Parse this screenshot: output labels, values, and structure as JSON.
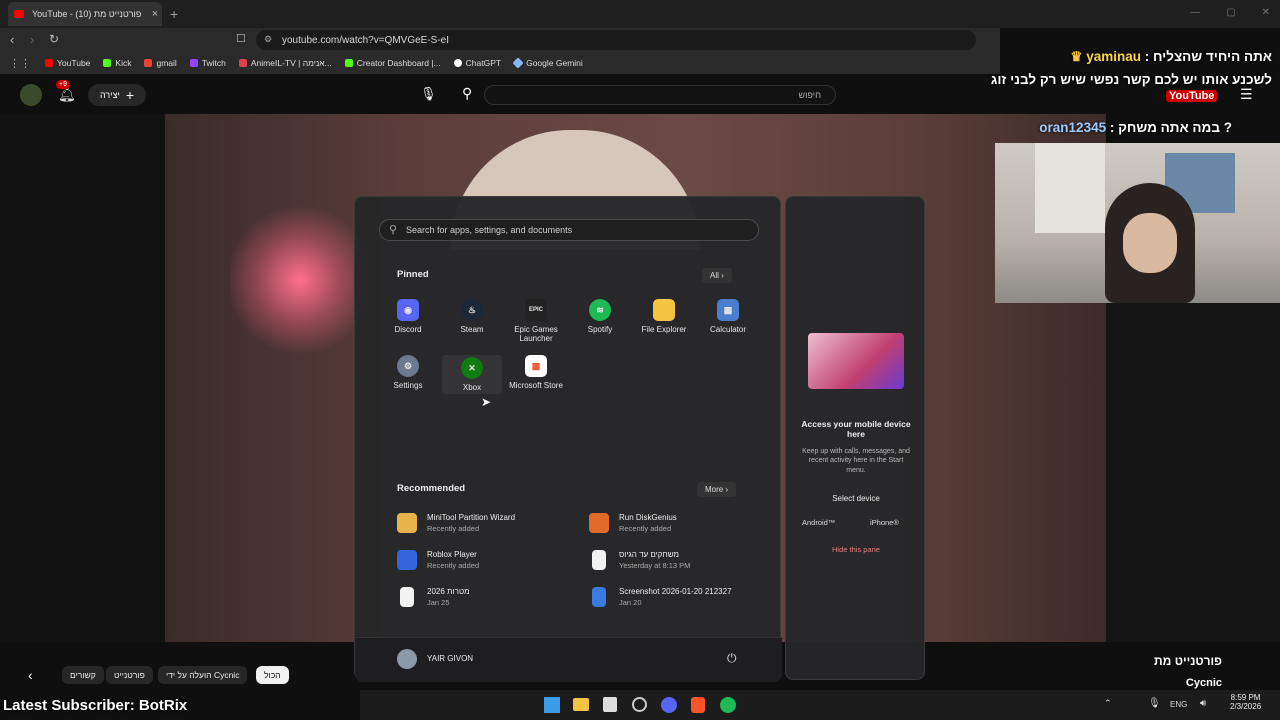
{
  "browser": {
    "tab_title": "YouTube - (10) פורטנייט מת",
    "new_tab_symbol": "+",
    "url": "youtube.com/watch?v=QMVGeE-S-eI",
    "bookmarks": [
      "YouTube",
      "Kick",
      "gmail",
      "Twitch",
      "AnimeIL-TV | אנימה...",
      "Creator Dashboard |...",
      "ChatGPT",
      "Google Gemini"
    ],
    "bookmark_colors": [
      "#ff0000",
      "#53fc18",
      "#ea4335",
      "#9146ff",
      "#e04050",
      "#53fc18",
      "#ffffff",
      "#8ab4f8"
    ]
  },
  "youtube": {
    "create_label": "יצירה",
    "notification_badge": "+9",
    "search_placeholder": "חיפוש",
    "logo_text": "YouTube",
    "video_title": "פורטנייט מת",
    "channel": "Cycnic",
    "chips": [
      "הכול",
      "הועלה על ידי Cycnic",
      "פורטנייט",
      "קשורים"
    ]
  },
  "start_menu": {
    "search_placeholder": "Search for apps, settings, and documents",
    "pinned_title": "Pinned",
    "all_label": "All",
    "pinned": [
      {
        "label": "Discord",
        "icon": "discord-icon",
        "color": "#5865f2"
      },
      {
        "label": "Steam",
        "icon": "steam-icon",
        "color": "#1b2838"
      },
      {
        "label": "Epic Games Launcher",
        "icon": "epic-icon",
        "color": "#222222"
      },
      {
        "label": "Spotify",
        "icon": "spotify-icon",
        "color": "#1db954"
      },
      {
        "label": "File Explorer",
        "icon": "folder-icon",
        "color": "#f4c542"
      },
      {
        "label": "Calculator",
        "icon": "calculator-icon",
        "color": "#4a7fd0"
      },
      {
        "label": "Settings",
        "icon": "gear-icon",
        "color": "#6b7a8f"
      },
      {
        "label": "Xbox",
        "icon": "xbox-icon",
        "color": "#107c10"
      },
      {
        "label": "Microsoft Store",
        "icon": "store-icon",
        "color": "#ffffff"
      }
    ],
    "recommended_title": "Recommended",
    "more_label": "More",
    "recommended": [
      {
        "name": "MiniTool Partition Wizard",
        "detail": "Recently added",
        "color": "#e8b34a"
      },
      {
        "name": "Run DiskGenius",
        "detail": "Recently added",
        "color": "#e06a2a"
      },
      {
        "name": "Roblox Player",
        "detail": "Recently added",
        "color": "#3366dd"
      },
      {
        "name": "משחקים עד הגיוס",
        "detail": "Yesterday at 8:13 PM",
        "color": "#f2f2f2"
      },
      {
        "name": "2026 מטרות",
        "detail": "Jan 25",
        "color": "#f2f2f2"
      },
      {
        "name": "Screenshot 2026-01-20 212327",
        "detail": "Jan 20",
        "color": "#3a7be0"
      }
    ],
    "user_name": "YAIR GIVON"
  },
  "side_pane": {
    "title": "Access your mobile device here",
    "description": "Keep up with calls, messages, and recent activity here in the Start menu.",
    "select_device": "Select device",
    "android": "Android™",
    "iphone": "iPhone®",
    "hide_label": "Hide this pane"
  },
  "chat": {
    "line1_user": "yaminau",
    "line1_text": "אתה היחיד שהצליח",
    "line2_text": "לשכנע אותו יש לכם קשר נפשי שיש רק לבני זוג",
    "line3_user": "oran12345",
    "line3_text": "? במה אתה משחק"
  },
  "overlay": {
    "latest_subscriber": "Latest Subscriber: BotRix"
  },
  "taskbar": {
    "language": "ENG",
    "time": "8:59 PM",
    "date": "2/3/2026"
  }
}
